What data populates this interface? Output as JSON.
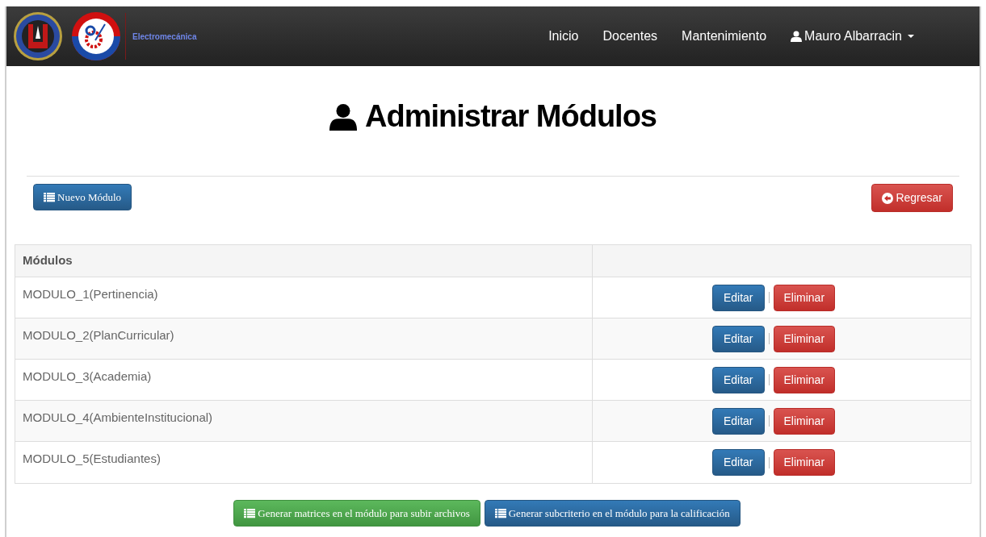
{
  "navbar": {
    "brand": "Electromecánica",
    "links": [
      "Inicio",
      "Docentes",
      "Mantenimiento"
    ],
    "user": {
      "name": "Mauro Albarracin"
    }
  },
  "title": "Administrar Módulos",
  "actions": {
    "new": "Nuevo Módulo",
    "back": "Regresar"
  },
  "table": {
    "columns": [
      "Módulos"
    ],
    "rows": [
      {
        "name": "MODULO_1(Pertinencia)",
        "edit": "Editar",
        "delete": "Eliminar"
      },
      {
        "name": "MODULO_2(PlanCurricular)",
        "edit": "Editar",
        "delete": "Eliminar"
      },
      {
        "name": "MODULO_3(Academia)",
        "edit": "Editar",
        "delete": "Eliminar"
      },
      {
        "name": "MODULO_4(AmbienteInstitucional)",
        "edit": "Editar",
        "delete": "Eliminar"
      },
      {
        "name": "MODULO_5(Estudiantes)",
        "edit": "Editar",
        "delete": "Eliminar"
      }
    ]
  },
  "footer_buttons": [
    {
      "label": "Generar matrices en el módulo para subir archivos",
      "kind": "success"
    },
    {
      "label": "Generar subcriterio en el módulo para la calificación",
      "kind": "primary"
    }
  ]
}
